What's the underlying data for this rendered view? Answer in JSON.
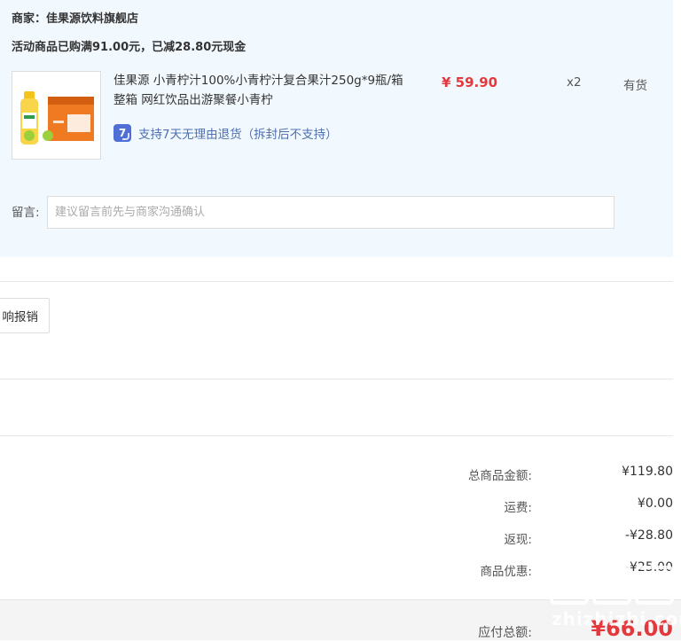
{
  "order": {
    "merchant": "商家：佳果源饮料旗舰店",
    "promo": "活动商品已购满91.00元，已减28.80元现金",
    "item": {
      "name": "佳果源 小青柠汁100%小青柠汁复合果汁250g*9瓶/箱 整箱 网红饮品出游聚餐小青柠",
      "price": "¥ 59.90",
      "qty": "x2",
      "stock": "有货",
      "return_policy": "支持7天无理由退货（拆封后不支持）",
      "return_badge": "7"
    },
    "note": {
      "label": "留言:",
      "placeholder": "建议留言前先与商家沟通确认"
    }
  },
  "invoice": {
    "button_label": "响报销"
  },
  "summary": {
    "items": [
      {
        "label": "总商品金额:",
        "value": "¥119.80"
      },
      {
        "label": "运费:",
        "value": "¥0.00"
      },
      {
        "label": "返现:",
        "value": "-¥28.80"
      },
      {
        "label": "商品优惠:",
        "value": "-¥25.00"
      }
    ],
    "total_label": "应付总额:",
    "total_value": "¥66.00"
  },
  "watermark": {
    "text": "zhizhizhi.com"
  },
  "colors": {
    "panel_bg": "#f2f9fe",
    "price_red": "#e4393c",
    "badge_blue": "#4f6fd6"
  }
}
